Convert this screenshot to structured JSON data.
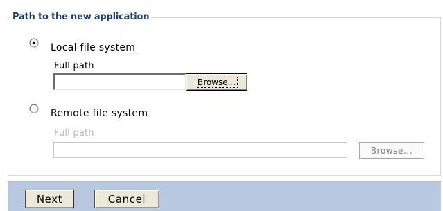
{
  "section": {
    "legend": "Path to the new application"
  },
  "local": {
    "label": "Local file system",
    "selected": true,
    "full_path_label": "Full path",
    "full_path_value": "",
    "browse_label": "Browse..."
  },
  "remote": {
    "label": "Remote file system",
    "selected": false,
    "full_path_label": "Full path",
    "full_path_value": "",
    "browse_label": "Browse..."
  },
  "footer": {
    "next_label": "Next",
    "cancel_label": "Cancel"
  },
  "colors": {
    "legend_text": "#1d3f6e",
    "footer_bg": "#b7c8e0",
    "disabled_text": "#b6b6b6"
  }
}
